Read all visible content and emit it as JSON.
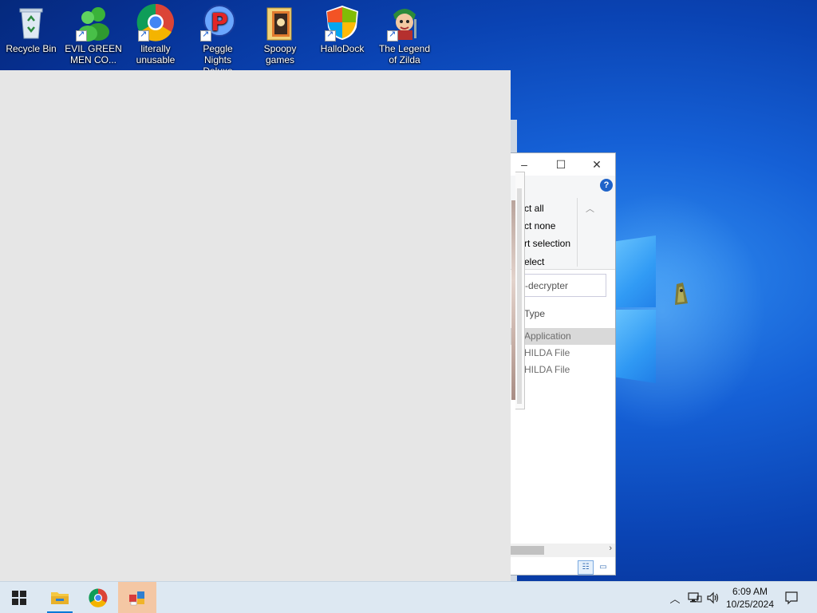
{
  "desktop": {
    "icons": [
      {
        "label": "Recycle Bin",
        "icon": "recycle-bin-icon"
      },
      {
        "label": "EVIL GREEN MEN CO...",
        "icon": "green-people-icon"
      },
      {
        "label": "literally unusable",
        "icon": "chrome-icon"
      },
      {
        "label": "Peggle Nights Deluxe",
        "icon": "peggle-icon"
      },
      {
        "label": "Spoopy games",
        "icon": "folder-icon"
      },
      {
        "label": "HalloDock",
        "icon": "shield-icon"
      },
      {
        "label": "The Legend of Zilda",
        "icon": "zilda-icon"
      }
    ]
  },
  "explorer": {
    "ribbon": {
      "select_all": "ct all",
      "select_none": "ct none",
      "invert_selection": "rt selection",
      "select_label": "elect"
    },
    "search_text": "-decrypter",
    "column_type": "Type",
    "rows": [
      {
        "type": "Application",
        "selected": true
      },
      {
        "type": "HILDA File",
        "selected": false
      },
      {
        "type": "HILDA File",
        "selected": false
      }
    ],
    "help_label": "?"
  },
  "taskbar": {
    "time": "6:09 AM",
    "date": "10/25/2024",
    "pinned": [
      "file-explorer-icon",
      "chrome-icon",
      "app-icon"
    ]
  },
  "colors": {
    "accent": "#0078d7",
    "taskbar_bg": "#dde8f2",
    "active_task": "#f4c7a4",
    "blank_window": "#e6e6e6"
  }
}
